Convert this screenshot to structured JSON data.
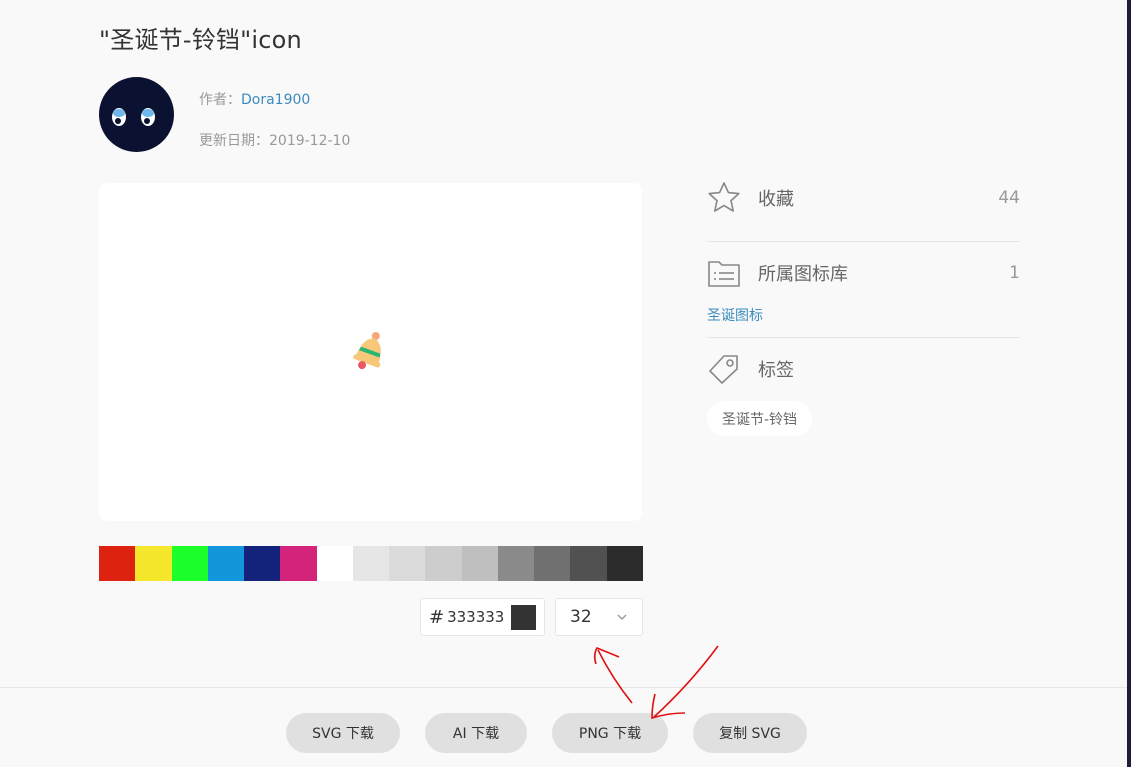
{
  "header": {
    "title": "\"圣诞节-铃铛\"icon"
  },
  "author": {
    "label": "作者：",
    "name": "Dora1900",
    "date_label": "更新日期：",
    "date": "2019-12-10"
  },
  "palette": {
    "swatches": [
      "#dd2210",
      "#f5e82c",
      "#1cff2b",
      "#1297dd",
      "#13227a",
      "#d4237a",
      "#ffffff",
      "#e6e6e6",
      "#dbdbdb",
      "#cdcdcd",
      "#bfbfbf",
      "#8a8a8a",
      "#707070",
      "#515151",
      "#2c2c2c"
    ]
  },
  "color_input": {
    "hash": "#",
    "value": "333333",
    "chip_color": "#333333"
  },
  "size_select": {
    "value": "32"
  },
  "sidebar": {
    "favorite": {
      "label": "收藏",
      "count": "44"
    },
    "library": {
      "label": "所属图标库",
      "count": "1",
      "link": "圣诞图标"
    },
    "tags": {
      "label": "标签",
      "items": [
        "圣诞节-铃铛"
      ]
    }
  },
  "actions": {
    "svg": "SVG 下载",
    "ai": "AI 下载",
    "png": "PNG 下载",
    "copy": "复制 SVG"
  },
  "colors": {
    "link": "#3d8bbd",
    "annotation": "#e01010"
  }
}
